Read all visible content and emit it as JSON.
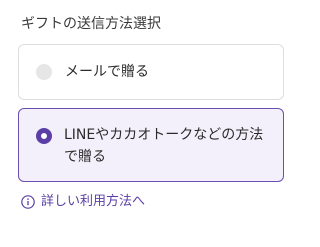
{
  "section": {
    "title": "ギフトの送信方法選択"
  },
  "options": [
    {
      "label": "メールで贈る",
      "selected": false
    },
    {
      "label": "LINEやカカオトークなどの方法で贈る",
      "selected": true
    }
  ],
  "help": {
    "label": "詳しい利用方法へ",
    "icon": "info-icon"
  },
  "colors": {
    "accent": "#5b3fa6",
    "selected_bg": "#f4f0fb",
    "unselected_radio": "#e6e6e6",
    "border": "#dedede"
  }
}
